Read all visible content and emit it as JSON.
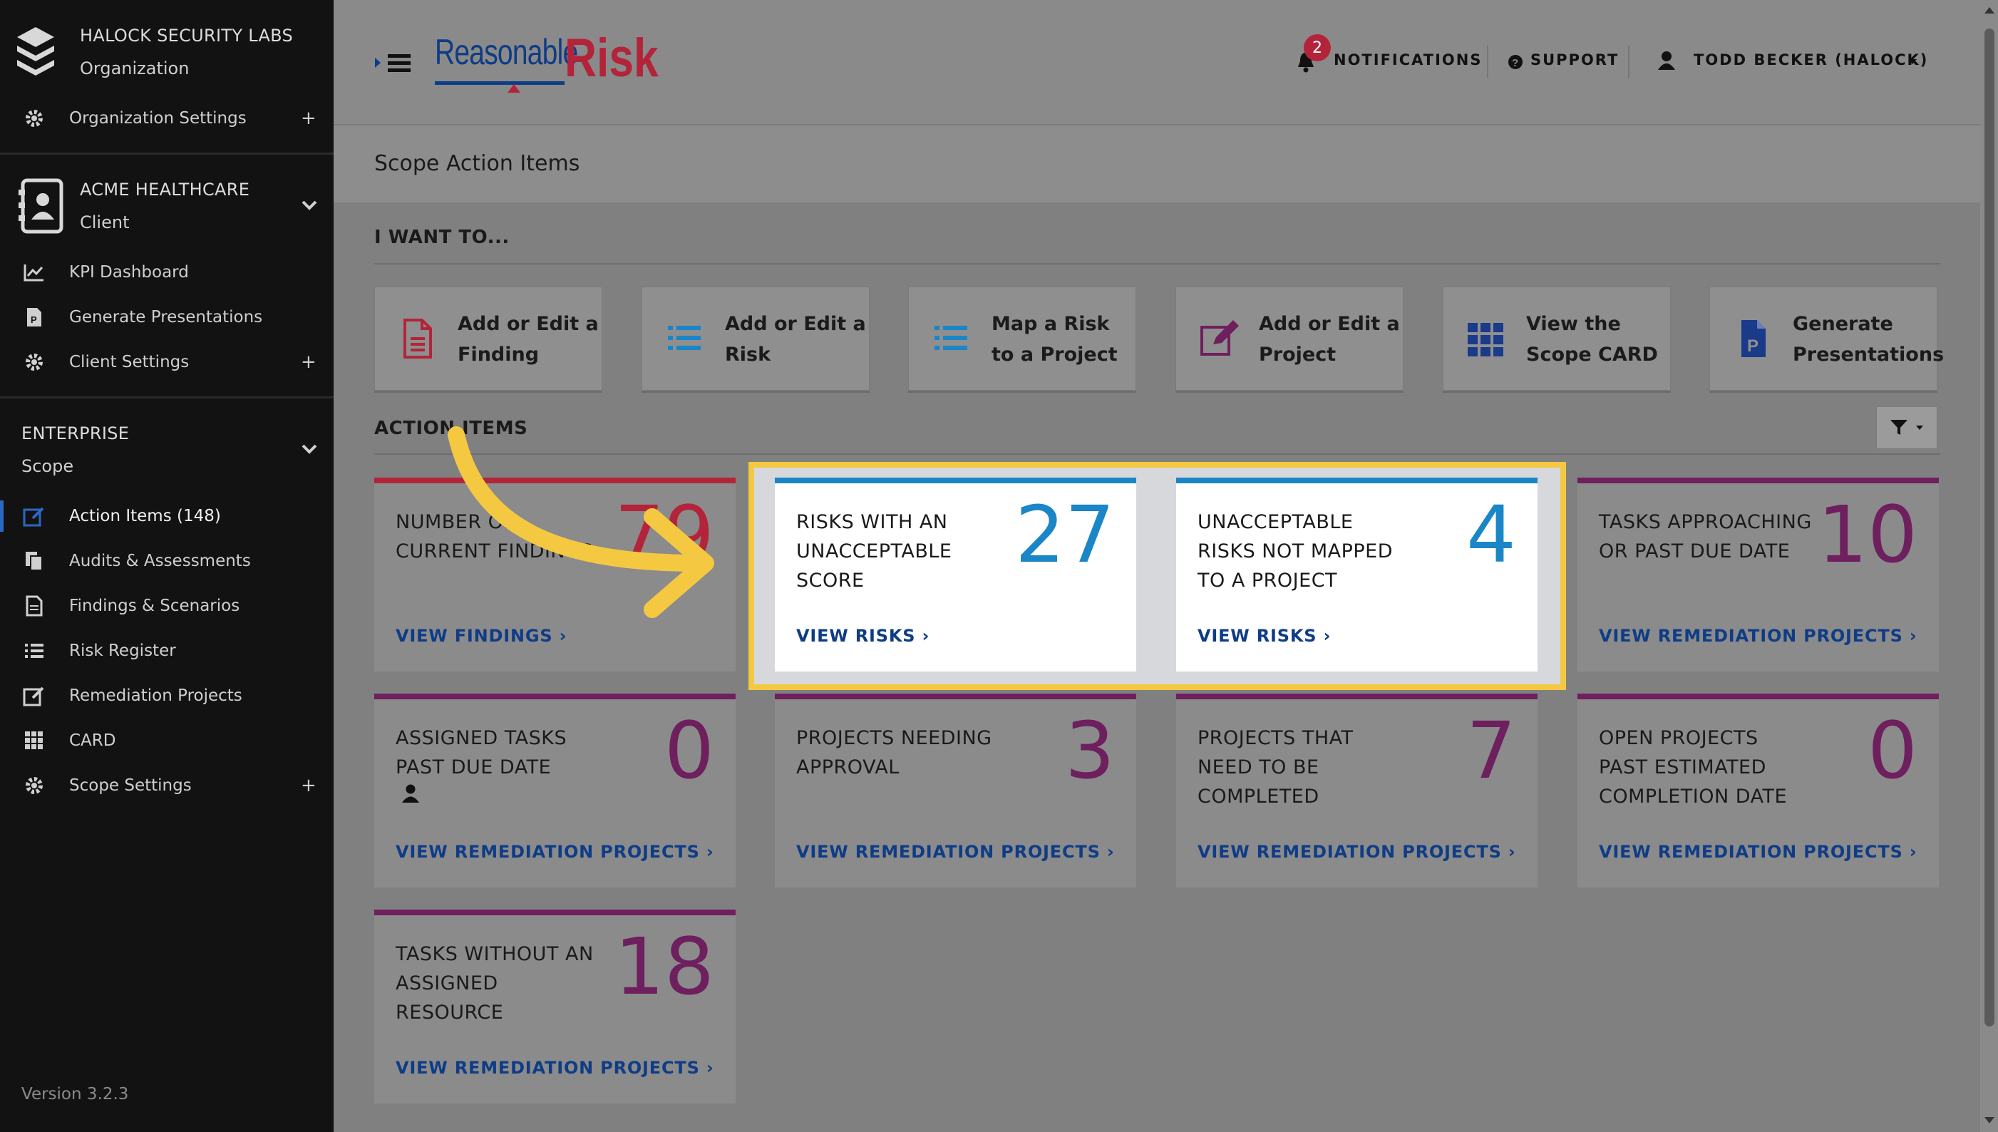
{
  "sidebar": {
    "org_name": "HALOCK SECURITY LABS",
    "org_type": "Organization",
    "org_settings": "Organization Settings",
    "client_name": "ACME HEALTHCARE",
    "client_type": "Client",
    "client_items": [
      {
        "label": "KPI Dashboard",
        "icon": "chart-line-icon"
      },
      {
        "label": "Generate Presentations",
        "icon": "presentation-file-icon"
      },
      {
        "label": "Client Settings",
        "icon": "gear-icon"
      }
    ],
    "scope_name": "ENTERPRISE",
    "scope_type": "Scope",
    "scope_items": [
      {
        "label": "Action Items (148)",
        "icon": "edit-square-icon"
      },
      {
        "label": "Audits & Assessments",
        "icon": "copy-files-icon"
      },
      {
        "label": "Findings & Scenarios",
        "icon": "document-icon"
      },
      {
        "label": "Risk Register",
        "icon": "list-icon"
      },
      {
        "label": "Remediation Projects",
        "icon": "edit-square-icon"
      },
      {
        "label": "CARD",
        "icon": "grid-icon"
      },
      {
        "label": "Scope Settings",
        "icon": "gear-icon"
      }
    ],
    "version": "Version 3.2.3"
  },
  "header": {
    "logo_left": "Reasonable",
    "logo_right": "Risk",
    "notification_count": "2",
    "notifications": "NOTIFICATIONS",
    "support": "SUPPORT",
    "user": "TODD BECKER (HALOCK)"
  },
  "page": {
    "title": "Scope Action Items",
    "want_title": "I WANT TO...",
    "action_items_title": "ACTION ITEMS"
  },
  "actions": [
    {
      "label": "Add or Edit a Finding",
      "icon": "document-icon",
      "color": "#b3243a"
    },
    {
      "label": "Add or Edit a Risk",
      "icon": "list-icon",
      "color": "#1a86c7"
    },
    {
      "label": "Map a Risk to a Project",
      "icon": "list-icon",
      "color": "#1a86c7"
    },
    {
      "label": "Add or Edit a Project",
      "icon": "edit-square-icon",
      "color": "#6e1f5e"
    },
    {
      "label": "View the Scope CARD",
      "icon": "grid-icon",
      "color": "#1a3a8a"
    },
    {
      "label": "Generate Presentations",
      "icon": "presentation-file-icon",
      "color": "#1a3a8a"
    }
  ],
  "cards": [
    {
      "title": "NUMBER OF CURRENT FINDINGS",
      "value": "79",
      "link": "VIEW FINDINGS",
      "color": "#b3243a"
    },
    {
      "title": "RISKS WITH AN UNACCEPTABLE SCORE",
      "value": "27",
      "link": "VIEW RISKS",
      "color": "#1a86c7"
    },
    {
      "title": "UNACCEPTABLE RISKS NOT MAPPED TO A PROJECT",
      "value": "4",
      "link": "VIEW RISKS",
      "color": "#1a86c7"
    },
    {
      "title": "TASKS APPROACHING OR PAST DUE DATE",
      "value": "10",
      "link": "VIEW REMEDIATION PROJECTS",
      "color": "#6e1f5e"
    },
    {
      "title": "ASSIGNED TASKS PAST DUE DATE",
      "value": "0",
      "link": "VIEW REMEDIATION PROJECTS",
      "color": "#6e1f5e"
    },
    {
      "title": "PROJECTS NEEDING APPROVAL",
      "value": "3",
      "link": "VIEW REMEDIATION PROJECTS",
      "color": "#6e1f5e"
    },
    {
      "title": "PROJECTS THAT NEED TO BE COMPLETED",
      "value": "7",
      "link": "VIEW REMEDIATION PROJECTS",
      "color": "#6e1f5e"
    },
    {
      "title": "OPEN PROJECTS PAST ESTIMATED COMPLETION DATE",
      "value": "0",
      "link": "VIEW REMEDIATION PROJECTS",
      "color": "#6e1f5e"
    },
    {
      "title": "TASKS WITHOUT AN ASSIGNED RESOURCE",
      "value": "18",
      "link": "VIEW REMEDIATION PROJECTS",
      "color": "#6e1f5e"
    }
  ],
  "link_chevron": "›",
  "colors": {
    "highlight": "#f5c842",
    "arrow": "#f5c842",
    "link": "#0f3c86"
  }
}
